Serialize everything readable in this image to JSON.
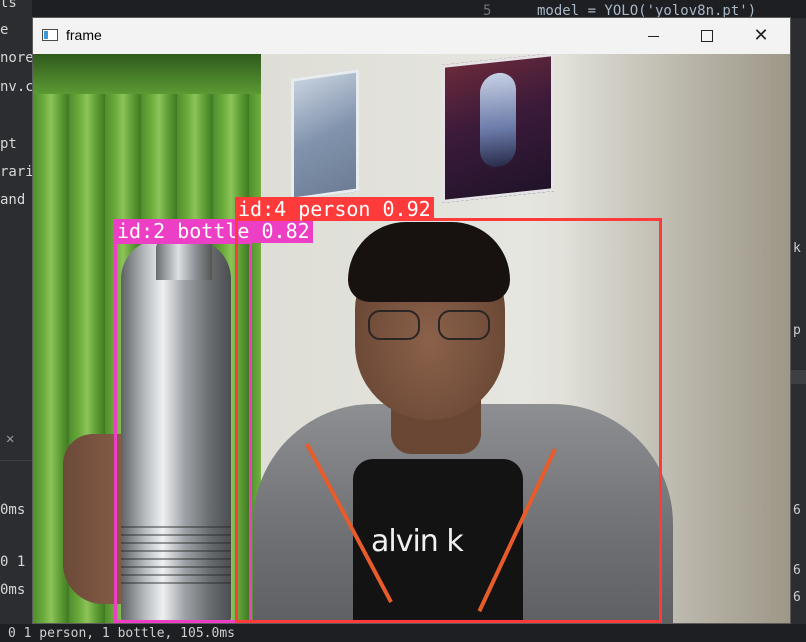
{
  "window": {
    "title": "frame",
    "minimize_icon": "minimize-icon",
    "maximize_icon": "maximize-icon",
    "close_icon": "close-icon"
  },
  "ide_background": {
    "left_fragments": [
      "ts",
      "e",
      "nore",
      "nv.cf",
      "pt",
      "rarie",
      "and C"
    ],
    "left_close_glyph": "✕",
    "left_times": [
      "0ms",
      "0 1",
      "0ms"
    ],
    "top_line_number": "5",
    "top_code": "model = YOLO('yolov8n.pt')",
    "right_fragments": [
      "k",
      "p"
    ],
    "right_numbers": [
      "6",
      "6",
      "6"
    ],
    "bottom_status": "0 1 person, 1 bottle, 105.0ms"
  },
  "detections": [
    {
      "id": 2,
      "class": "bottle",
      "confidence": 0.82,
      "label": "id:2 bottle 0.82",
      "color": "#ec3fc6"
    },
    {
      "id": 4,
      "class": "person",
      "confidence": 0.92,
      "label": "id:4 person 0.92",
      "color": "#ff3a3a"
    }
  ],
  "scene": {
    "shirt_text": "alvin k"
  }
}
